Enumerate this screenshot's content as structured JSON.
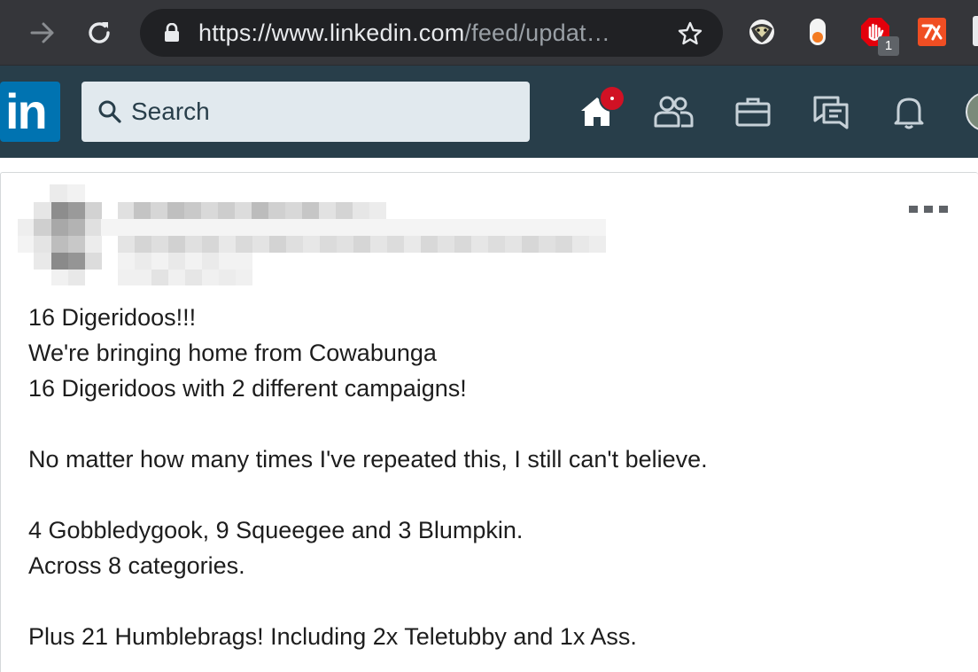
{
  "browser": {
    "url_scheme_host": "https://www.linkedin.com",
    "url_path": "/feed/updat…",
    "icons": {
      "forward": "arrow-right-icon",
      "reload": "reload-icon",
      "lock": "lock-icon",
      "bookmark": "star-icon"
    },
    "extensions": [
      {
        "name": "badger-extension-icon"
      },
      {
        "name": "toggle-extension-icon"
      },
      {
        "name": "adblock-extension-icon",
        "badge": "1"
      },
      {
        "name": "translate-extension-icon"
      }
    ]
  },
  "linkedin": {
    "logo": "in",
    "search_placeholder": "Search",
    "nav": [
      {
        "name": "home-icon",
        "notification": true
      },
      {
        "name": "my-network-icon"
      },
      {
        "name": "jobs-icon"
      },
      {
        "name": "messaging-icon"
      },
      {
        "name": "notifications-icon"
      }
    ],
    "colors": {
      "header_bg": "#283e4a",
      "logo_bg": "#0073b1",
      "search_bg": "#e1e9ee",
      "badge_red": "#d11124"
    }
  },
  "post": {
    "author_blurred": true,
    "lines": [
      "16 Digeridoos!!!",
      "We're bringing home from Cowabunga",
      "16 Digeridoos with 2 different campaigns!",
      "",
      "No matter how many times I've repeated this, I still can't believe.",
      "",
      "4 Gobbledygook, 9 Squeegee and 3 Blumpkin.",
      "Across 8 categories.",
      "",
      "Plus 21 Humblebrags! Including 2x Teletubby and 1x Ass."
    ]
  }
}
